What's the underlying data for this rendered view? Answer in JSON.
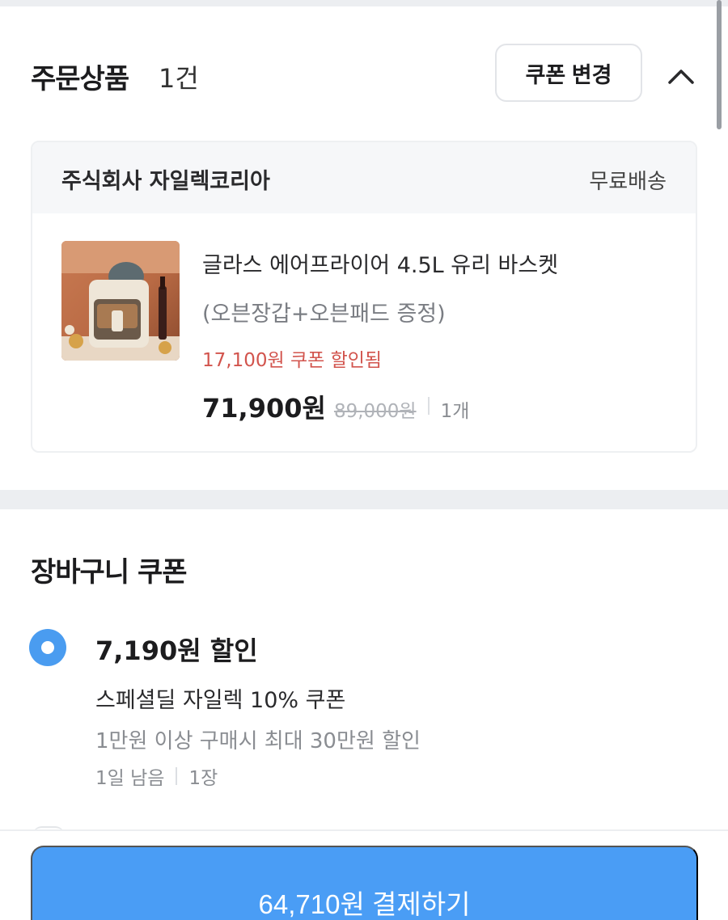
{
  "order": {
    "title": "주문상품",
    "count": "1건",
    "coupon_change_label": "쿠폰 변경",
    "collapse_icon": "chevron-up-icon"
  },
  "seller": {
    "name": "주식회사 자일렉코리아",
    "shipping": "무료배송"
  },
  "product": {
    "name": "글라스 에어프라이어 4.5L 유리 바스켓",
    "option": "(오븐장갑+오븐패드 증정)",
    "coupon_applied": "17,100원 쿠폰 할인됨",
    "price": "71,900원",
    "original_price": "89,000원",
    "quantity": "1개",
    "thumbnail_icon": "air-fryer-product-image"
  },
  "cart_coupon": {
    "title": "장바구니 쿠폰",
    "coupons": [
      {
        "selected": true,
        "amount": "7,190원 할인",
        "name": "스페셜딜 자일렉 10% 쿠폰",
        "condition": "1만원 이상 구매시 최대 30만원 할인",
        "remaining": "1일 남음",
        "count": "1장"
      }
    ]
  },
  "pay": {
    "label": "64,710원 결제하기"
  },
  "colors": {
    "accent": "#4a9df5",
    "discount_text": "#d2544d",
    "section_bg": "#f6f7f9"
  }
}
